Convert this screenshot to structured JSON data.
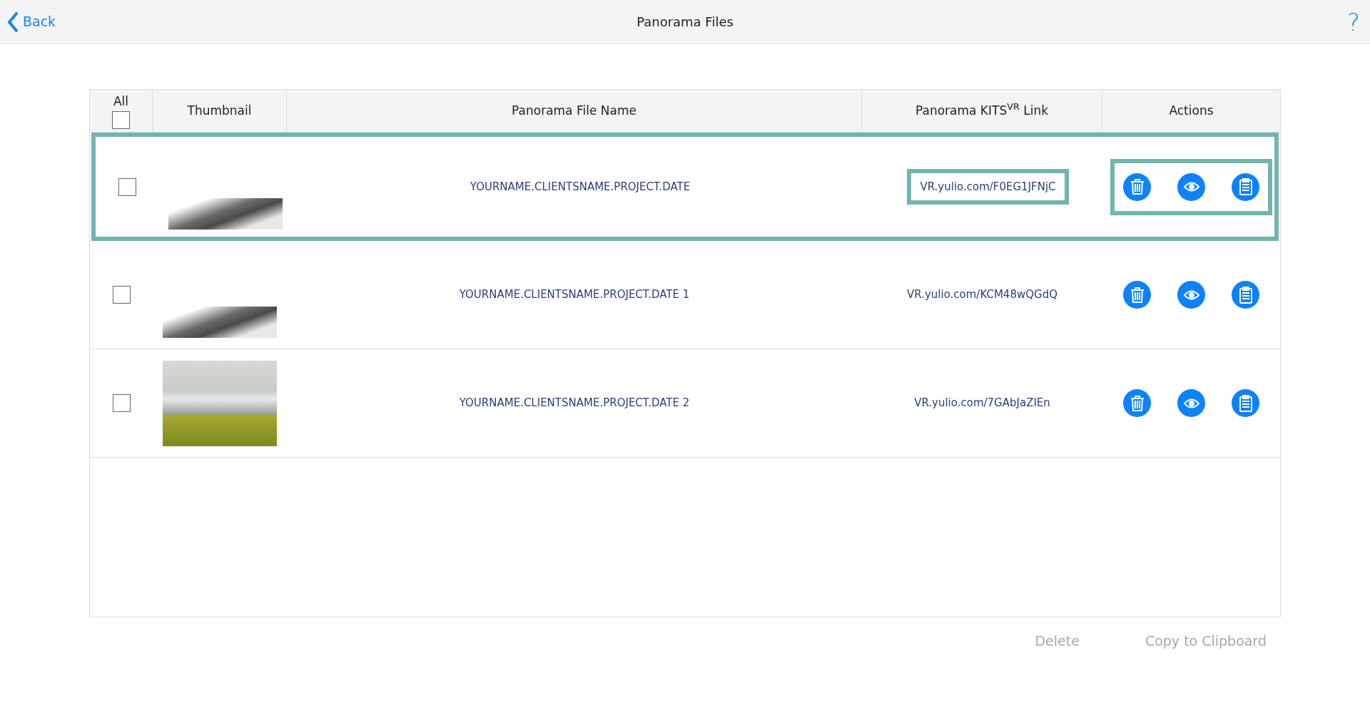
{
  "top_bar": {
    "back_label": "Back",
    "title": "Panorama Files",
    "help": "?"
  },
  "table": {
    "columns": [
      {
        "kind": "select",
        "label": "All",
        "checked": false
      },
      {
        "kind": "text",
        "label": "Thumbnail"
      },
      {
        "kind": "text",
        "label": "Panorama File Name"
      },
      {
        "kind": "text",
        "label": "Panorama KITS$^{VR}$ Link"
      },
      {
        "kind": "text",
        "label": "Actions"
      }
    ],
    "rows": [
      {
        "checked": false,
        "kind": "cropped",
        "file_name": "YOURNAME.CLIENTSNAME.PROJECT.DATE",
        "link": "VR.yulio.com/F0EG1JFNjC",
        "highlighted": true,
        "link_highlighted": true,
        "actions_highlighted": true
      },
      {
        "checked": false,
        "kind": "cropped",
        "file_name": "YOURNAME.CLIENTSNAME.PROJECT.DATE 1",
        "link": "VR.yulio.com/KCM48wQGdQ",
        "highlighted": false,
        "link_highlighted": false,
        "actions_highlighted": false
      },
      {
        "checked": false,
        "kind": "full",
        "file_name": "YOURNAME.CLIENTSNAME.PROJECT.DATE 2",
        "link": "VR.yulio.com/7GAbJaZIEn",
        "highlighted": false,
        "link_highlighted": false,
        "actions_highlighted": false
      }
    ]
  },
  "footer_buttons": [
    {
      "label": "Delete",
      "disabled": true
    },
    {
      "label": "Copy to Clipboard",
      "disabled": true
    }
  ]
}
